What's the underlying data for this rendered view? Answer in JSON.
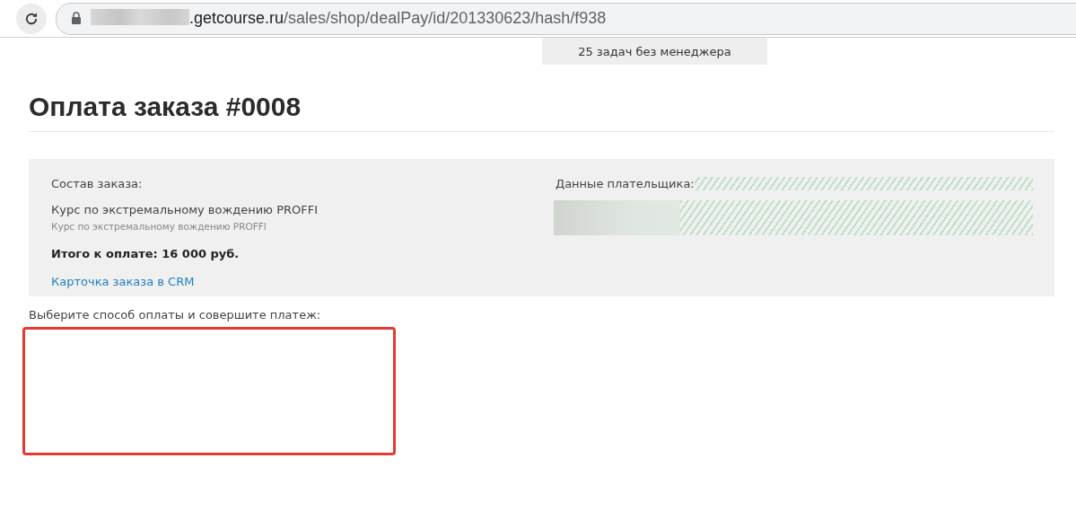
{
  "browser": {
    "url_host": ".getcourse.ru",
    "url_path": "/sales/shop/dealPay/id/201330623/hash/f938"
  },
  "tasks_tab": "25 задач без менеджера",
  "title": "Оплата заказа #0008",
  "order": {
    "heading": "Состав заказа:",
    "item_name": "Курс по экстремальному вождению PROFFI",
    "item_description": "Курс по экстремальному вождению PROFFI",
    "total": "Итого к оплате: 16 000 руб.",
    "crm_link": "Карточка заказа в CRM"
  },
  "payer": {
    "heading": "Данные плательщика:"
  },
  "payment_prompt": "Выберите способ оплаты и совершите платеж:"
}
